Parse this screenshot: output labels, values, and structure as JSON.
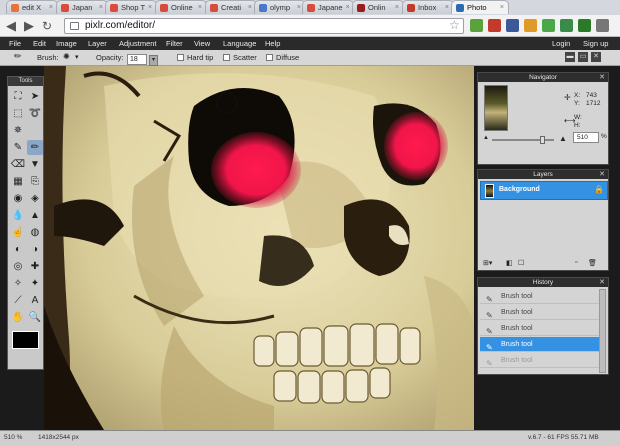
{
  "tabs": [
    {
      "label": "edit X",
      "color": "#e8723c",
      "active": false
    },
    {
      "label": "Japan",
      "color": "#d94b3a",
      "active": false
    },
    {
      "label": "Shop T",
      "color": "#d94b3a",
      "active": false
    },
    {
      "label": "Online",
      "color": "#d94b3a",
      "active": false
    },
    {
      "label": "Creati",
      "color": "#d94b3a",
      "active": false
    },
    {
      "label": "olymp",
      "color": "#4a78c8",
      "active": false
    },
    {
      "label": "Japane",
      "color": "#d94b3a",
      "active": false
    },
    {
      "label": "Onlin",
      "color": "#9a1c1c",
      "active": false
    },
    {
      "label": "Inbox",
      "color": "#c23a2a",
      "active": false
    },
    {
      "label": "Photo",
      "color": "#2a6bb2",
      "active": true
    }
  ],
  "browser": {
    "url": "pixlr.com/editor/",
    "extensions": [
      {
        "name": "evernote-icon",
        "color": "#5aa23c"
      },
      {
        "name": "gmail-icon",
        "color": "#c23a2a"
      },
      {
        "name": "facebook-icon",
        "color": "#3b5998"
      },
      {
        "name": "rss-icon",
        "color": "#e09a2a"
      },
      {
        "name": "maps-icon",
        "color": "#4aa84a"
      },
      {
        "name": "pocket-icon",
        "color": "#3a8a4a"
      },
      {
        "name": "clipper-icon",
        "color": "#2a7a2a"
      },
      {
        "name": "wrench-icon",
        "color": "#777777"
      }
    ]
  },
  "menu": {
    "items": [
      "File",
      "Edit",
      "Image",
      "Layer",
      "Adjustment",
      "Filter",
      "View",
      "Language",
      "Help"
    ],
    "login": "Login",
    "signup": "Sign up"
  },
  "options": {
    "brush_label": "Brush:",
    "opacity_label": "Opacity:",
    "opacity_value": "18",
    "hard_tip": "Hard tip",
    "scatter": "Scatter",
    "diffuse": "Diffuse"
  },
  "tools_panel": {
    "title": "Tools",
    "icons": [
      "crop-icon",
      "move-icon",
      "marquee-icon",
      "lasso-icon",
      "wand-icon",
      "",
      "pencil-icon",
      "brush-icon",
      "eraser-icon",
      "bucket-icon",
      "gradient-icon",
      "clone-icon",
      "colorpicker-icon",
      "drawing-icon",
      "blur-icon",
      "sharpen-icon",
      "smudge-icon",
      "sponge-icon",
      "dodge-icon",
      "burn-icon",
      "redeye-icon",
      "spotheal-icon",
      "bloat-icon",
      "pinch-icon",
      "eyedropper-icon",
      "type-icon",
      "hand-icon",
      "zoom-icon"
    ],
    "glyphs": [
      "⛶",
      "➤",
      "⬚",
      "➰",
      "✵",
      "",
      "✎",
      "✏",
      "⌫",
      "▼",
      "▦",
      "⎘",
      "◉",
      "◈",
      "💧",
      "▲",
      "☝",
      "◍",
      "◐",
      "◑",
      "◎",
      "✚",
      "✧",
      "✦",
      "⟋",
      "A",
      "✋",
      "🔍"
    ]
  },
  "navigator": {
    "title": "Navigator",
    "x_label": "X:",
    "x_value": "743",
    "y_label": "Y:",
    "y_value": "1712",
    "w_label": "W:",
    "h_label": "H:",
    "zoom_value": "510",
    "zoom_unit": "%"
  },
  "layers": {
    "title": "Layers",
    "items": [
      {
        "name": "Background"
      }
    ]
  },
  "history": {
    "title": "History",
    "items": [
      {
        "label": "Brush tool",
        "state": "normal"
      },
      {
        "label": "Brush tool",
        "state": "normal"
      },
      {
        "label": "Brush tool",
        "state": "normal"
      },
      {
        "label": "Brush tool",
        "state": "active"
      },
      {
        "label": "Brush tool",
        "state": "dim"
      }
    ]
  },
  "status": {
    "zoom": "510 %",
    "dimensions": "1418x2544 px",
    "version": "v.6.7 - 61 FPS 55.71 MB"
  }
}
